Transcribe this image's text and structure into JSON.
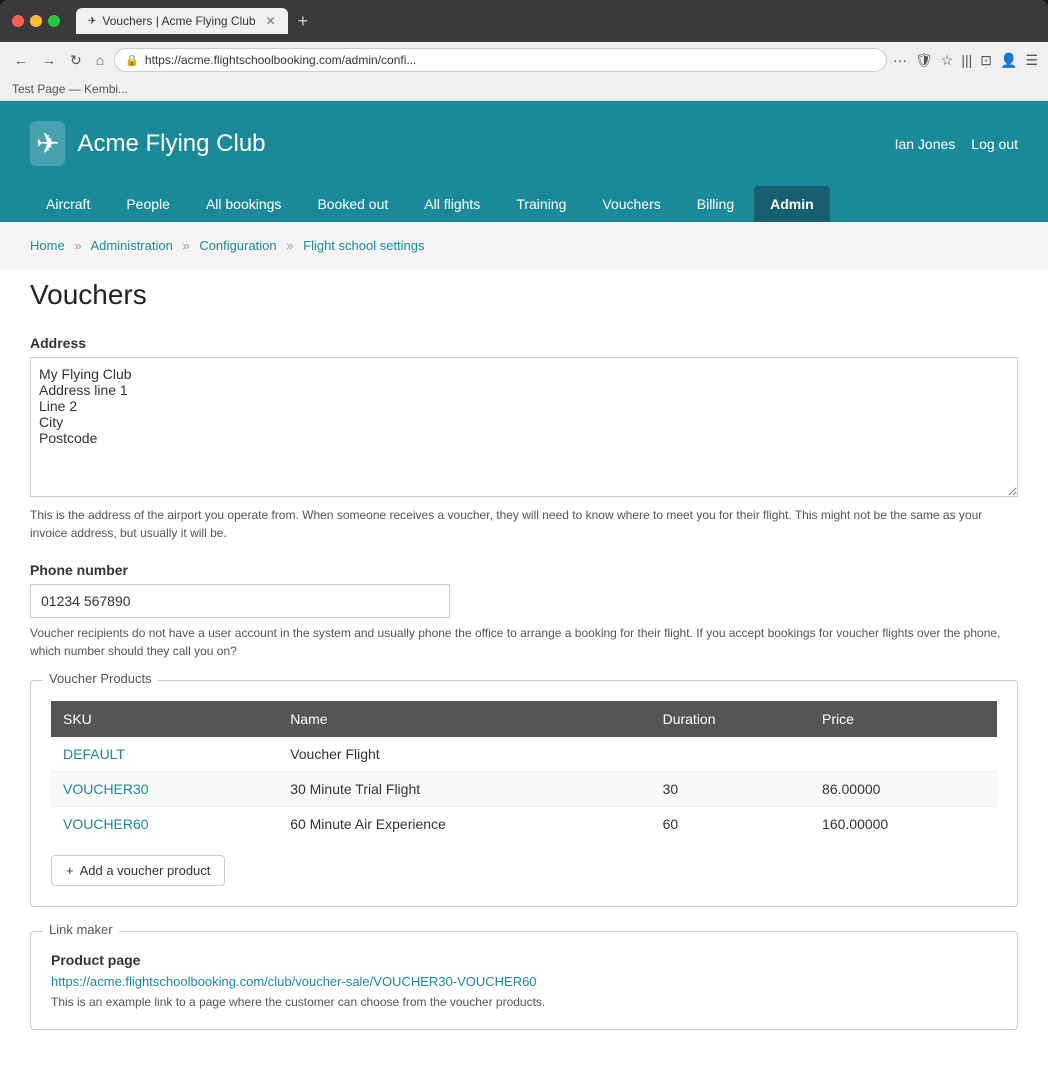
{
  "browser": {
    "tab_title": "Vouchers | Acme Flying Club",
    "tab_favicon": "✈",
    "url": "https://acme.flightschoolbooking.com/admin/confi...",
    "bookmarks_bar": "Test Page — Kembi..."
  },
  "header": {
    "logo_icon": "✈",
    "site_name": "Acme Flying Club",
    "username": "Ian Jones",
    "logout_label": "Log out"
  },
  "nav": {
    "items": [
      {
        "label": "Aircraft",
        "active": false
      },
      {
        "label": "People",
        "active": false
      },
      {
        "label": "All bookings",
        "active": false
      },
      {
        "label": "Booked out",
        "active": false
      },
      {
        "label": "All flights",
        "active": false
      },
      {
        "label": "Training",
        "active": false
      },
      {
        "label": "Vouchers",
        "active": false
      },
      {
        "label": "Billing",
        "active": false
      },
      {
        "label": "Admin",
        "active": true
      }
    ]
  },
  "breadcrumb": {
    "items": [
      {
        "label": "Home",
        "link": true
      },
      {
        "label": "Administration",
        "link": true
      },
      {
        "label": "Configuration",
        "link": true
      },
      {
        "label": "Flight school settings",
        "link": true
      }
    ],
    "separator": "»"
  },
  "page": {
    "title": "Vouchers"
  },
  "address_section": {
    "label": "Address",
    "value": "My Flying Club\nAddress line 1\nLine 2\nCity\nPostcode",
    "help": "This is the address of the airport you operate from. When someone receives a voucher, they will need to know where to meet you for their flight. This might not be the same as your invoice address, but usually it will be."
  },
  "phone_section": {
    "label": "Phone number",
    "value": "01234 567890",
    "help": "Voucher recipients do not have a user account in the system and usually phone the office to arrange a booking for their flight. If you accept bookings for voucher flights over the phone, which number should they call you on?"
  },
  "voucher_products": {
    "panel_title": "Voucher Products",
    "table": {
      "headers": [
        "SKU",
        "Name",
        "Duration",
        "Price"
      ],
      "rows": [
        {
          "sku": "DEFAULT",
          "name": "Voucher Flight",
          "duration": "",
          "price": ""
        },
        {
          "sku": "VOUCHER30",
          "name": "30 Minute Trial Flight",
          "duration": "30",
          "price": "86.00000"
        },
        {
          "sku": "VOUCHER60",
          "name": "60 Minute Air Experience",
          "duration": "60",
          "price": "160.00000"
        }
      ]
    },
    "add_button": "+ Add a voucher product"
  },
  "link_maker": {
    "panel_title": "Link maker",
    "product_page_label": "Product page",
    "product_page_url": "https://acme.flightschoolbooking.com/club/voucher-sale/VOUCHER30-VOUCHER60",
    "product_page_help": "This is an example link to a page where the customer can choose from the voucher products."
  }
}
